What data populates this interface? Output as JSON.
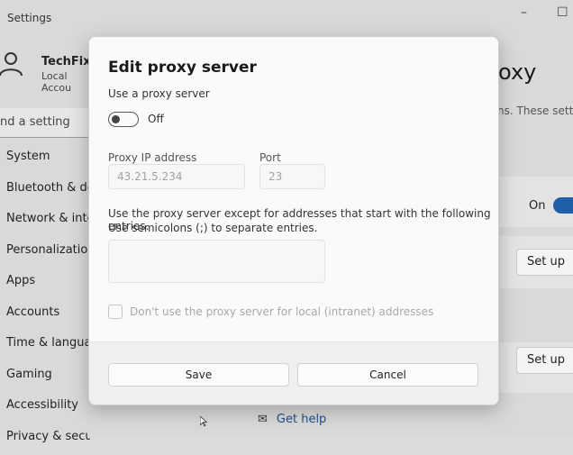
{
  "window": {
    "title": "Settings"
  },
  "profile": {
    "name": "TechFixIt",
    "account_type": "Local Accou"
  },
  "search": {
    "placeholder": "nd a setting"
  },
  "sidebar": {
    "items": [
      {
        "label": "System"
      },
      {
        "label": "Bluetooth & devi"
      },
      {
        "label": "Network & intern"
      },
      {
        "label": "Personalization"
      },
      {
        "label": "Apps"
      },
      {
        "label": "Accounts"
      },
      {
        "label": "Time & language"
      },
      {
        "label": "Gaming"
      },
      {
        "label": "Accessibility"
      },
      {
        "label": "Privacy & security"
      }
    ]
  },
  "background": {
    "heading": "oxy",
    "description": "ns. These setting",
    "toggle_label": "On",
    "setup_button_1": "Set up",
    "setup_button_2": "Set up",
    "get_help": "Get help"
  },
  "dialog": {
    "title": "Edit proxy server",
    "use_proxy_label": "Use a proxy server",
    "toggle_state": "Off",
    "ip_label": "Proxy IP address",
    "ip_value": "43.21.5.234",
    "port_label": "Port",
    "port_value": "23",
    "exceptions_text_1": "Use the proxy server except for addresses that start with the following entries.",
    "exceptions_text_2": "Use semicolons (;) to separate entries.",
    "exceptions_value": "",
    "local_checkbox_label": "Don't use the proxy server for local (intranet) addresses",
    "save_label": "Save",
    "cancel_label": "Cancel"
  },
  "icons": [
    "person-icon",
    "minimize-icon",
    "maximize-icon",
    "help-icon",
    "cursor-icon"
  ]
}
